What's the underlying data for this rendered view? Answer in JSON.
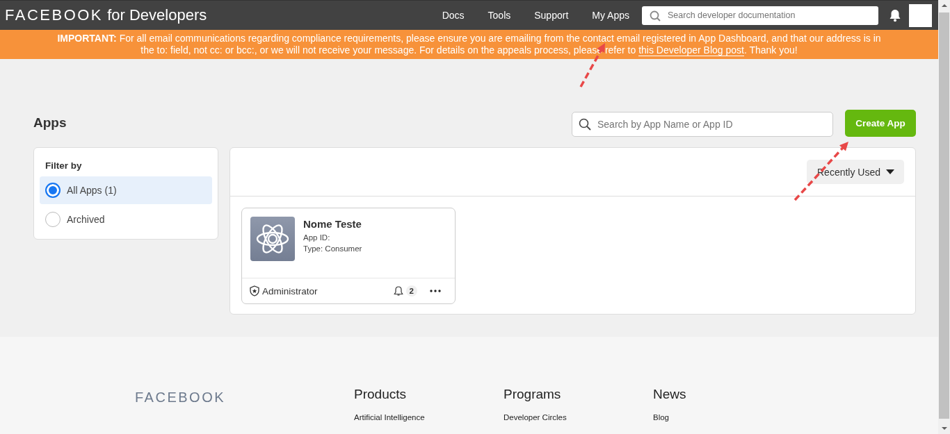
{
  "nav": {
    "logo_bold": "FACEBOOK",
    "logo_rest": "for Developers",
    "links": [
      {
        "label": "Docs"
      },
      {
        "label": "Tools"
      },
      {
        "label": "Support"
      },
      {
        "label": "My Apps"
      }
    ],
    "search": {
      "placeholder": "Search developer documentation"
    }
  },
  "banner": {
    "text": "**IMPORTANT:** For all email communications regarding compliance requirements, please ensure you are emailing from the contact email registered in App Dashboard, and that our address is in the to: field, not cc: or bcc:, or we will not receive your message. For details on the appeals process, please refer to",
    "link": "this Developer Blog post",
    "after": ". Thank you!"
  },
  "page": {
    "title": "Apps",
    "search": {
      "placeholder": "Search by App Name or App ID"
    },
    "create_button": "Create App"
  },
  "filter": {
    "title": "Filter by",
    "options": [
      {
        "label": "All Apps (1)",
        "selected": true
      },
      {
        "label": "Archived",
        "selected": false
      }
    ]
  },
  "sort": {
    "label": "Recently Used"
  },
  "apps": [
    {
      "name": "Nome Teste",
      "app_id": "App ID:",
      "type": "Type: Consumer",
      "role": "Administrator",
      "notifications": "2"
    }
  ],
  "footer": {
    "logo": "FACEBOOK",
    "columns": [
      {
        "heading": "Products",
        "links": [
          "Artificial Intelligence"
        ]
      },
      {
        "heading": "Programs",
        "links": [
          "Developer Circles"
        ]
      },
      {
        "heading": "News",
        "links": [
          "Blog"
        ]
      }
    ]
  },
  "annotations": [
    {
      "kind": "arrow"
    },
    {
      "kind": "arrow"
    }
  ]
}
